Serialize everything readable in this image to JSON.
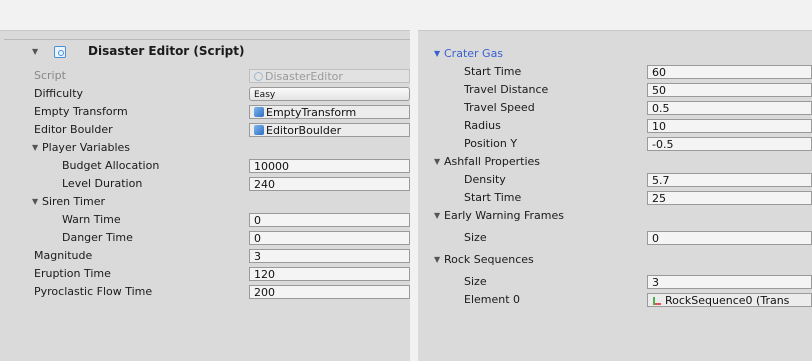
{
  "left": {
    "component_title": "Disaster Editor (Script)",
    "script": {
      "label": "Script",
      "value": "DisasterEditor"
    },
    "difficulty": {
      "label": "Difficulty",
      "value": "Easy"
    },
    "empty_transform": {
      "label": "Empty Transform",
      "value": "EmptyTransform"
    },
    "editor_boulder": {
      "label": "Editor Boulder",
      "value": "EditorBoulder"
    },
    "player_variables": {
      "label": "Player Variables",
      "budget_allocation": {
        "label": "Budget Allocation",
        "value": "10000"
      },
      "level_duration": {
        "label": "Level Duration",
        "value": "240"
      }
    },
    "siren_timer": {
      "label": "Siren Timer",
      "warn_time": {
        "label": "Warn Time",
        "value": "0"
      },
      "danger_time": {
        "label": "Danger Time",
        "value": "0"
      }
    },
    "magnitude": {
      "label": "Magnitude",
      "value": "3"
    },
    "eruption_time": {
      "label": "Eruption Time",
      "value": "120"
    },
    "pyroclastic_flow_time": {
      "label": "Pyroclastic Flow Time",
      "value": "200"
    }
  },
  "right": {
    "crater_gas": {
      "label": "Crater Gas",
      "start_time": {
        "label": "Start Time",
        "value": "60"
      },
      "travel_distance": {
        "label": "Travel Distance",
        "value": "50"
      },
      "travel_speed": {
        "label": "Travel Speed",
        "value": "0.5"
      },
      "radius": {
        "label": "Radius",
        "value": "10"
      },
      "position_y": {
        "label": "Position Y",
        "value": "-0.5"
      }
    },
    "ashfall_properties": {
      "label": "Ashfall Properties",
      "density": {
        "label": "Density",
        "value": "5.7"
      },
      "start_time": {
        "label": "Start Time",
        "value": "25"
      }
    },
    "early_warning_frames": {
      "label": "Early Warning Frames",
      "size": {
        "label": "Size",
        "value": "0"
      }
    },
    "rock_sequences": {
      "label": "Rock Sequences",
      "size": {
        "label": "Size",
        "value": "3"
      },
      "element_0": {
        "label": "Element 0",
        "value": "RockSequence0 (Trans"
      }
    }
  },
  "icons": {
    "foldout_open": "▼",
    "checkbox_state": "checked"
  },
  "colors": {
    "foldout_highlight": "#3a5fd0",
    "panel_bg": "#dadada"
  }
}
